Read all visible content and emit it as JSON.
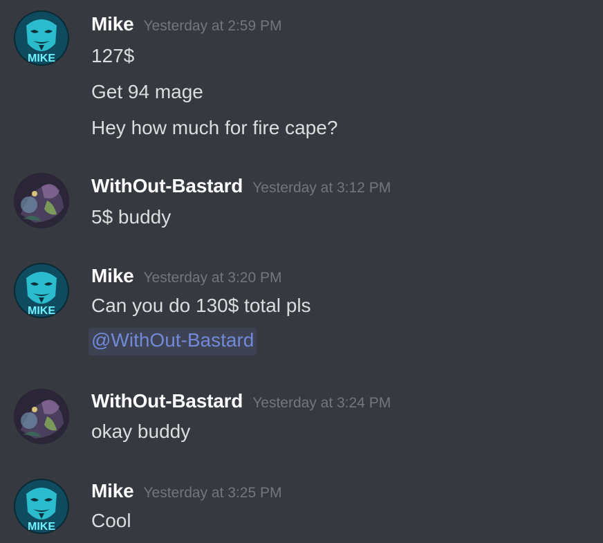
{
  "colors": {
    "background": "#36393f",
    "username": "#ffffff",
    "timestamp": "#72767d",
    "message_text": "#dcddde",
    "mention_text": "#7289da"
  },
  "messages": [
    {
      "author": "Mike",
      "timestamp": "Yesterday at 2:59 PM",
      "avatar_icon": "anonymous-mask-mike-avatar",
      "avatar_text": "MIKE",
      "lines": [
        "127$",
        "Get 94 mage",
        "Hey how much for fire cape?"
      ]
    },
    {
      "author": "WithOut-Bastard",
      "timestamp": "Yesterday at 3:12 PM",
      "avatar_icon": "fantasy-character-avatar",
      "lines": [
        "5$ buddy"
      ]
    },
    {
      "author": "Mike",
      "timestamp": "Yesterday at 3:20 PM",
      "avatar_icon": "anonymous-mask-mike-avatar",
      "avatar_text": "MIKE",
      "lines": [
        "Can you do 130$ total pls"
      ],
      "mention": "@WithOut-Bastard"
    },
    {
      "author": "WithOut-Bastard",
      "timestamp": "Yesterday at 3:24 PM",
      "avatar_icon": "fantasy-character-avatar",
      "lines": [
        "okay buddy"
      ]
    },
    {
      "author": "Mike",
      "timestamp": "Yesterday at 3:25 PM",
      "avatar_icon": "anonymous-mask-mike-avatar",
      "avatar_text": "MIKE",
      "lines": [
        "Cool"
      ]
    }
  ]
}
